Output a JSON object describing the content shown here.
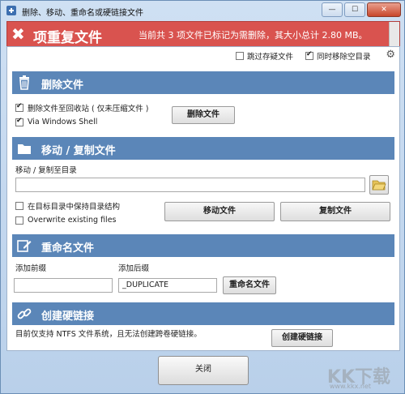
{
  "window": {
    "title": "删除、移动、重命名或硬链接文件",
    "controls": [
      "—",
      "☐",
      "✕"
    ]
  },
  "banner": {
    "title": "项重复文件",
    "status": "当前共 3 项文件已标记为需删除，其大小总计 2.80 MB。"
  },
  "options": {
    "skip_suspect": "跳过存疑文件",
    "skip_suspect_checked": false,
    "remove_empty": "同时移除空目录",
    "remove_empty_checked": true
  },
  "delete": {
    "title": "删除文件",
    "recycle_label": "删除文件至回收站 ( 仅未压缩文件 )",
    "recycle_checked": true,
    "shell_label": "Via Windows Shell",
    "shell_checked": true,
    "button": "删除文件"
  },
  "move": {
    "title": "移动 / 复制文件",
    "target_label": "移动 / 复制至目录",
    "target_value": "",
    "keep_structure_label": "在目标目录中保持目录结构",
    "keep_structure_checked": false,
    "overwrite_label": "Overwrite existing files",
    "overwrite_checked": false,
    "move_button": "移动文件",
    "copy_button": "复制文件"
  },
  "rename": {
    "title": "重命名文件",
    "prefix_label": "添加前缀",
    "prefix_value": "",
    "suffix_label": "添加后缀",
    "suffix_value": "_DUPLICATE",
    "button": "重命名文件"
  },
  "hardlink": {
    "title": "创建硬链接",
    "note": "目前仅支持 NTFS 文件系统，且无法创建跨卷硬链接。",
    "button": "创建硬链接"
  },
  "footer": {
    "close": "关闭"
  },
  "watermark": {
    "text": "KK下载",
    "sub": "www.kkx.net"
  },
  "colors": {
    "banner": "#d9534f",
    "section": "#5b86b8",
    "window": "#b9d0ea"
  }
}
